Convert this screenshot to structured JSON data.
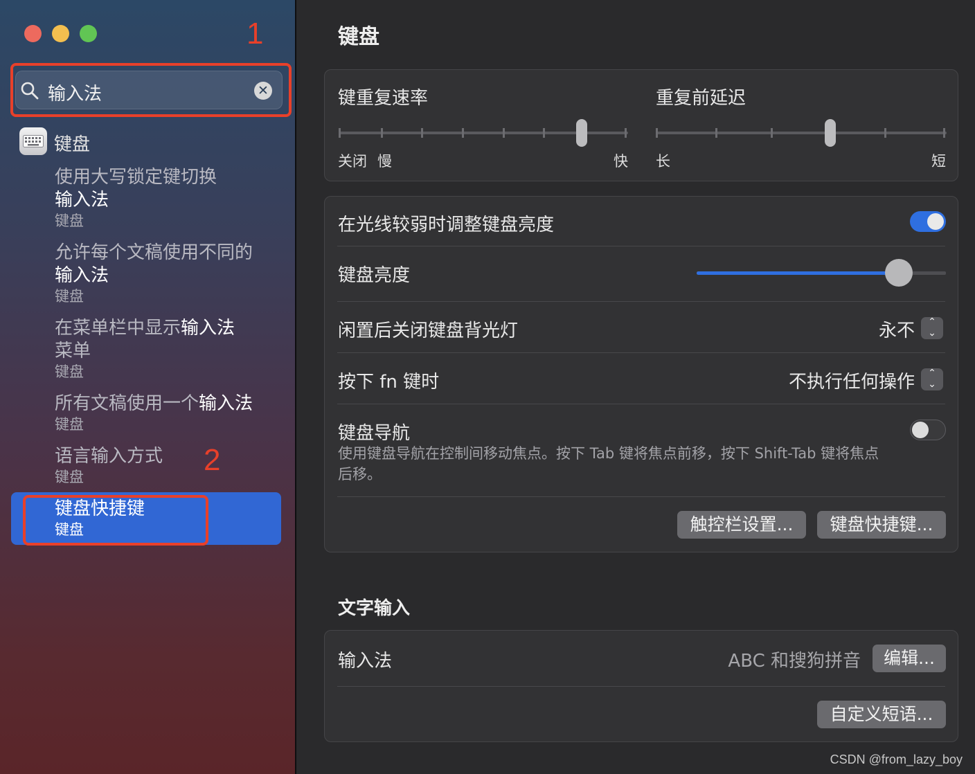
{
  "colors": {
    "accent": "#3167d4",
    "annotation": "#e8402a",
    "toggle_on": "#2f6fe0"
  },
  "annotations": {
    "one": "1",
    "two": "2"
  },
  "sidebar": {
    "search": {
      "value": "输入法",
      "icon": "search-icon",
      "clear_icon": "clear-icon"
    },
    "category": {
      "label": "键盘",
      "icon": "keyboard-icon"
    },
    "results": [
      {
        "title_pre": "使用大写锁定键切换",
        "title_match": "输入法",
        "title_post": "",
        "sub": "键盘"
      },
      {
        "title_pre": "允许每个文稿使用不同的",
        "title_match": "输入法",
        "title_post": "",
        "sub": "键盘"
      },
      {
        "title_pre": "在菜单栏中显示",
        "title_match": "输入法",
        "title_post": "菜单",
        "sub": "键盘"
      },
      {
        "title_pre": "所有文稿使用一个",
        "title_match": "输入法",
        "title_post": "",
        "sub": "键盘"
      },
      {
        "title_pre": "语言输入方式",
        "title_match": "",
        "title_post": "",
        "sub": "键盘"
      },
      {
        "title_pre": "键盘快捷键",
        "title_match": "",
        "title_post": "",
        "sub": "键盘",
        "selected": true
      }
    ]
  },
  "main": {
    "title": "键盘",
    "repeat": {
      "rate_label": "键重复速率",
      "rate_min_off": "关闭",
      "rate_slow": "慢",
      "rate_fast": "快",
      "rate_value_fraction": 0.84,
      "delay_label": "重复前延迟",
      "delay_long": "长",
      "delay_short": "短",
      "delay_value_fraction": 0.6
    },
    "settings": {
      "auto_brightness_label": "在光线较弱时调整键盘亮度",
      "auto_brightness_on": true,
      "brightness_label": "键盘亮度",
      "brightness_fraction": 0.81,
      "backlight_off_label": "闲置后关闭键盘背光灯",
      "backlight_off_value": "永不",
      "fn_label": "按下 fn 键时",
      "fn_value": "不执行任何操作",
      "nav_label": "键盘导航",
      "nav_on": false,
      "nav_desc": "使用键盘导航在控制间移动焦点。按下 Tab 键将焦点前移，按下 Shift-Tab 键将焦点后移。",
      "touchbar_button": "触控栏设置...",
      "shortcuts_button": "键盘快捷键..."
    },
    "text_input": {
      "section_title": "文字输入",
      "input_source_label": "输入法",
      "input_source_value": "ABC 和搜狗拼音",
      "edit_button": "编辑...",
      "replacements_button": "自定义短语..."
    }
  },
  "watermark": "CSDN @from_lazy_boy"
}
